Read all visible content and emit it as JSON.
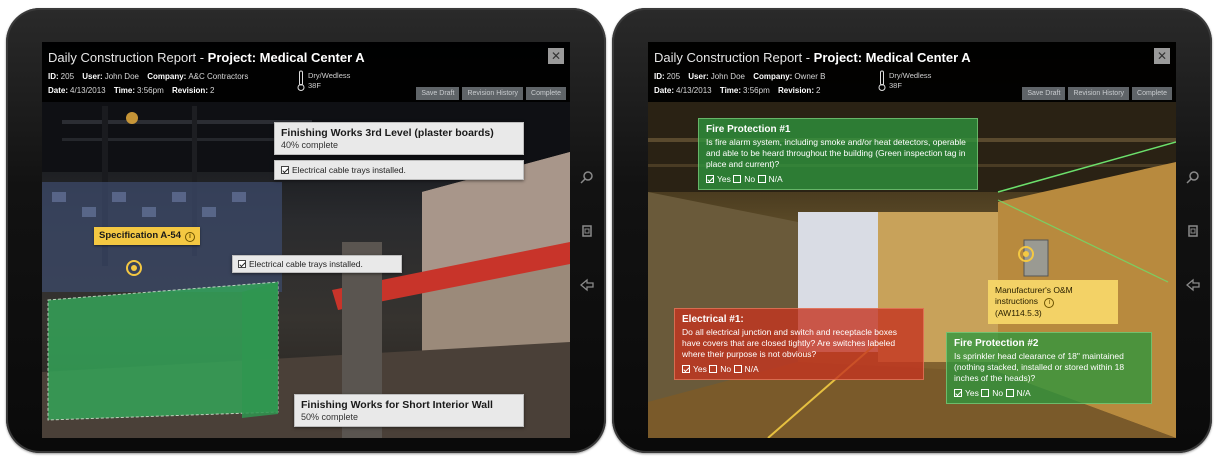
{
  "left": {
    "header": {
      "title_prefix": "Daily Construction Report - ",
      "title_project": "Project: Medical Center A",
      "id_label": "ID:",
      "id_value": "205",
      "user_label": "User:",
      "user_value": "John Doe",
      "company_label": "Company:",
      "company_value": "A&C Contractors",
      "weather_line1": "Dry/Wedless",
      "weather_line2": "38F",
      "date_label": "Date:",
      "date_value": "4/13/2013",
      "time_label": "Time:",
      "time_value": "3:56pm",
      "revision_label": "Revision:",
      "revision_value": "2",
      "buttons": [
        "Save Draft",
        "Revision History",
        "Complete"
      ]
    },
    "callouts": {
      "finishing_3rd_title": "Finishing Works 3rd Level (plaster boards)",
      "finishing_3rd_progress": "40% complete",
      "finishing_3rd_check": "Electrical cable trays installed.",
      "cable_trays_check": "Electrical cable trays installed.",
      "spec_tag": "Specification A-54",
      "interior_wall_title": "Finishing Works for Short Interior Wall",
      "interior_wall_progress": "50% complete"
    }
  },
  "right": {
    "header": {
      "title_prefix": "Daily Construction Report - ",
      "title_project": "Project: Medical Center A",
      "id_label": "ID:",
      "id_value": "205",
      "user_label": "User:",
      "user_value": "John Doe",
      "company_label": "Company:",
      "company_value": "Owner B",
      "weather_line1": "Dry/Wedless",
      "weather_line2": "38F",
      "date_label": "Date:",
      "date_value": "4/13/2013",
      "time_label": "Time:",
      "time_value": "3:56pm",
      "revision_label": "Revision:",
      "revision_value": "2",
      "buttons": [
        "Save Draft",
        "Revision History",
        "Complete"
      ]
    },
    "fire1": {
      "title": "Fire Protection #1",
      "text": "Is fire alarm system, including smoke and/or heat detectors, operable and able to be heard throughout the building (Green inspection tag in place and current)?",
      "yes": "Yes",
      "no": "No",
      "na": "N/A"
    },
    "electrical": {
      "title": "Electrical #1:",
      "text": "Do all electrical junction and switch and receptacle boxes have covers that are closed tightly? Are switches labeled where their purpose is not obvious?",
      "yes": "Yes",
      "no": "No",
      "na": "N/A"
    },
    "manufacturer": {
      "text": "Manufacturer's O&M instructions",
      "code": "(AW114.5.3)"
    },
    "fire2": {
      "title": "Fire Protection #2",
      "text": "Is sprinkler head clearance of 18\" maintained (nothing stacked, installed or stored within 18 inches of the heads)?",
      "yes": "Yes",
      "no": "No",
      "na": "N/A"
    }
  },
  "colors": {
    "green_overlay": "#2e963e",
    "red_overlay": "#c43420",
    "yellow_tag": "#f4c842",
    "header_bg": "#000000"
  }
}
